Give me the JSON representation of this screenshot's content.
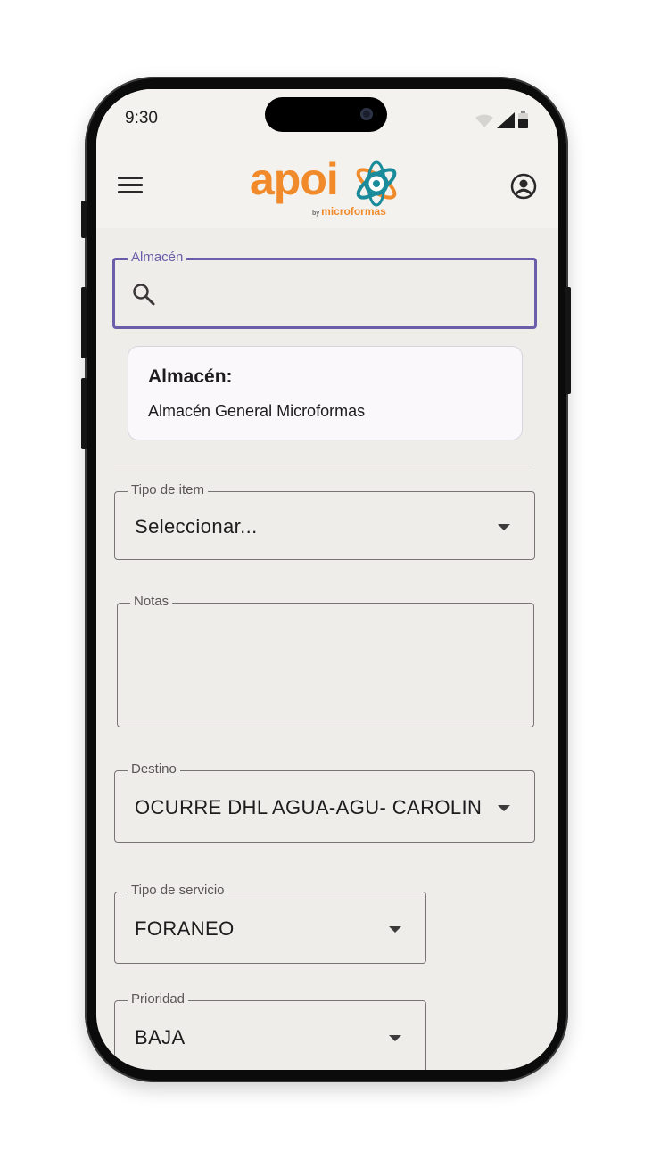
{
  "status_bar": {
    "time": "9:30"
  },
  "app_bar": {
    "logo_text": "apoi",
    "logo_by": "by",
    "logo_brand": "microformas"
  },
  "almacen_search": {
    "label": "Almacén",
    "value": ""
  },
  "almacen_card": {
    "title": "Almacén:",
    "value": "Almacén General Microformas"
  },
  "tipo_item": {
    "label": "Tipo de item",
    "value": "Seleccionar..."
  },
  "notas": {
    "label": "Notas",
    "value": ""
  },
  "destino": {
    "label": "Destino",
    "value": "OCURRE DHL AGUA-AGU- CAROLIN"
  },
  "tipo_servicio": {
    "label": "Tipo de servicio",
    "value": "FORANEO"
  },
  "prioridad": {
    "label": "Prioridad",
    "value": "BAJA"
  },
  "colors": {
    "accent": "#6a5ea8",
    "brand_orange": "#f08a2a",
    "brand_teal": "#1a8b9a",
    "background": "#efedea"
  }
}
